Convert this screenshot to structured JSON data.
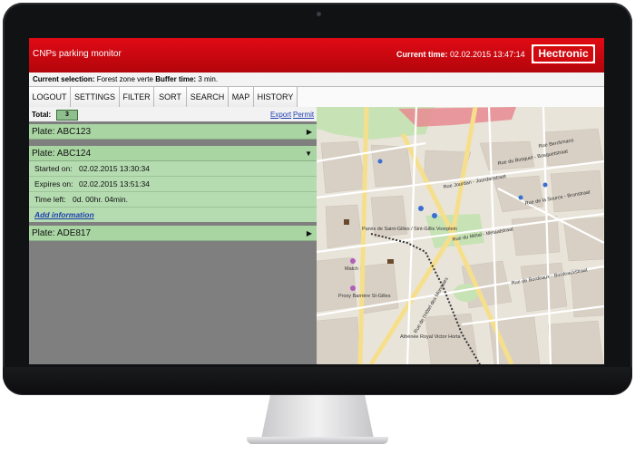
{
  "header": {
    "title": "CNPs parking monitor",
    "current_time_label": "Current time:",
    "current_time": "02.02.2015 13:47:14",
    "logo_text": "Hectronic"
  },
  "selection": {
    "label": "Current selection:",
    "value": "Forest zone verte",
    "buffer_label": "Buffer time:",
    "buffer_value": "3 min."
  },
  "toolbar": [
    "LOGOUT",
    "SETTINGS",
    "FILTER",
    "SORT",
    "SEARCH",
    "MAP",
    "HISTORY"
  ],
  "list": {
    "total_label": "Total:",
    "total_value": "3",
    "export_link": "Export",
    "permit_link": "Permit",
    "plates": [
      {
        "label": "Plate:  ABC123",
        "expanded": false
      },
      {
        "label": "Plate:  ABC124",
        "expanded": true
      },
      {
        "label": "Plate:  ADE817",
        "expanded": false
      }
    ],
    "details": {
      "started_label": "Started on:",
      "started_value": "02.02.2015 13:30:34",
      "expires_label": "Expires on:",
      "expires_value": "02.02.2015 13:51:34",
      "timeleft_label": "Time left:",
      "timeleft_value": "0d. 00hr. 04min.",
      "add_info": "Add information"
    },
    "arrow_collapsed": "▶",
    "arrow_expanded": "▼"
  },
  "map": {
    "labels": {
      "parvis": "Parvis de Saint-Gilles / Sint-Gillis Voorplein",
      "match": "Match",
      "proxy": "Proxy Barrière St-Gilles",
      "athenee": "Athénée Royal Victor Horta",
      "bosquet": "Rue du Bosquet - Bosquetstraat",
      "metal": "Rue du Métal - Metaalstraat",
      "bordeaux": "Rue de Bordeaux - Bordeauxstraat",
      "source": "Rue de la Source - Bronstraat",
      "berckmans": "Rue Berckmans",
      "hotel_des_monnaies": "Rue de l'Hôtel des Monnaies",
      "jourdan": "Rue Jourdan - Jourdanstraat",
      "bronstraat": "Rue de la Source"
    },
    "colors": {
      "bg": "#e9e4da",
      "block": "#d6cfc4",
      "park": "#c7e3b5",
      "major_road": "#f6df8c",
      "tram": "#222222",
      "water_red": "#e88b92"
    }
  }
}
